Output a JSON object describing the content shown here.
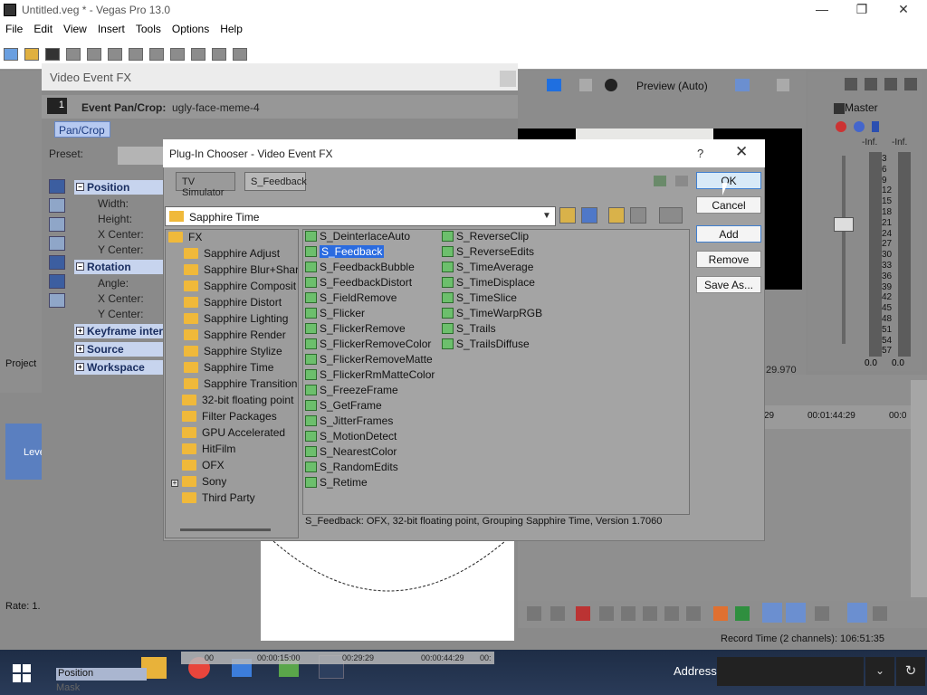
{
  "app": {
    "title": "Untitled.veg * - Vegas Pro 13.0",
    "menu": [
      "File",
      "Edit",
      "View",
      "Insert",
      "Tools",
      "Options",
      "Help"
    ]
  },
  "video_event_fx": {
    "title": "Video Event FX",
    "event_label": "Event Pan/Crop:",
    "event_value": "ugly-face-meme-4",
    "fx_number": "1",
    "chain_chip": "Pan/Crop",
    "preset_label": "Preset:",
    "groups": [
      {
        "title": "Position",
        "fields": [
          "Width:",
          "Height:",
          "X Center:",
          "Y Center:"
        ]
      },
      {
        "title": "Rotation",
        "fields": [
          "Angle:",
          "X Center:",
          "Y Center:"
        ]
      },
      {
        "title": "Keyframe inter",
        "fields": []
      },
      {
        "title": "Source",
        "fields": []
      },
      {
        "title": "Workspace",
        "fields": []
      }
    ]
  },
  "plugin_chooser": {
    "title": "Plug-In Chooser - Video Event FX",
    "help": "?",
    "close": "✕",
    "chain": [
      "TV Simulator",
      "S_Feedback"
    ],
    "current_folder": "Sapphire Time",
    "tree": [
      {
        "label": "FX",
        "level": 0
      },
      {
        "label": "Sapphire Adjust",
        "level": 1
      },
      {
        "label": "Sapphire Blur+Shar",
        "level": 1
      },
      {
        "label": "Sapphire Composit",
        "level": 1
      },
      {
        "label": "Sapphire Distort",
        "level": 1
      },
      {
        "label": "Sapphire Lighting",
        "level": 1
      },
      {
        "label": "Sapphire Render",
        "level": 1
      },
      {
        "label": "Sapphire Stylize",
        "level": 1
      },
      {
        "label": "Sapphire Time",
        "level": 1
      },
      {
        "label": "Sapphire Transition",
        "level": 1
      },
      {
        "label": "32-bit floating point",
        "level": 0
      },
      {
        "label": "Filter Packages",
        "level": 0
      },
      {
        "label": "GPU Accelerated",
        "level": 0
      },
      {
        "label": "HitFilm",
        "level": 0
      },
      {
        "label": "OFX",
        "level": 0
      },
      {
        "label": "Sony",
        "level": 0
      },
      {
        "label": "Third Party",
        "level": 0
      }
    ],
    "plugins_col1": [
      "S_DeinterlaceAuto",
      "S_Feedback",
      "S_FeedbackBubble",
      "S_FeedbackDistort",
      "S_FieldRemove",
      "S_Flicker",
      "S_FlickerRemove",
      "S_FlickerRemoveColor",
      "S_FlickerRemoveMatte",
      "S_FlickerRmMatteColor",
      "S_FreezeFrame",
      "S_GetFrame",
      "S_JitterFrames",
      "S_MotionDetect",
      "S_NearestColor",
      "S_RandomEdits",
      "S_Retime"
    ],
    "plugins_col2": [
      "S_ReverseClip",
      "S_ReverseEdits",
      "S_TimeAverage",
      "S_TimeDisplace",
      "S_TimeSlice",
      "S_TimeWarpRGB",
      "S_Trails",
      "S_TrailsDiffuse"
    ],
    "selected": "S_Feedback",
    "status": "S_Feedback: OFX, 32-bit floating point, Grouping  Sapphire Time, Version 1.7060",
    "buttons": {
      "ok": "OK",
      "cancel": "Cancel",
      "add": "Add",
      "remove": "Remove",
      "save_as": "Save As..."
    }
  },
  "preview": {
    "mode": "Preview (Auto)",
    "time": "29.970"
  },
  "master": {
    "title": "Master",
    "inf_left": "-Inf.",
    "inf_right": "-Inf.",
    "scale": [
      "3",
      "6",
      "9",
      "12",
      "15",
      "18",
      "21",
      "24",
      "27",
      "30",
      "33",
      "36",
      "39",
      "42",
      "45",
      "48",
      "51",
      "54",
      "57"
    ],
    "value_left": "0.0",
    "value_right": "0.0"
  },
  "timeline": {
    "ruler": [
      "29",
      "00:01:44:29",
      "00:0"
    ],
    "record_time": "Record Time (2 channels): 106:51:35"
  },
  "bottom_left": {
    "rate": "Rate: 1.",
    "project_tab": "Project",
    "level": "Leve",
    "track_fx_position": "Position",
    "track_fx_mask": "Mask",
    "mini_times": [
      "00",
      "00:00:15:00",
      "00:29:29",
      "00:00:44:29",
      "00:"
    ]
  },
  "taskbar": {
    "address_label": "Address"
  }
}
